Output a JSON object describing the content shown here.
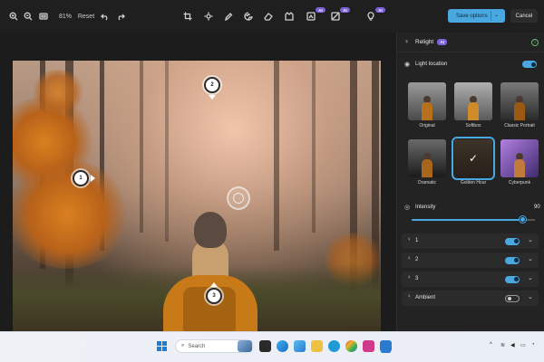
{
  "toolbar": {
    "zoom": "81%",
    "reset_label": "Reset",
    "ai_badge": "AI",
    "save_label": "Save options",
    "cancel_label": "Cancel",
    "icons": [
      "zoom-in-icon",
      "zoom-out-icon",
      "fit-icon",
      "undo-icon",
      "redo-icon",
      "crop-icon",
      "brightness-icon",
      "markup-icon",
      "color-icon",
      "erase-icon",
      "background-icon",
      "generative-erase-icon",
      "relight-icon"
    ]
  },
  "canvas": {
    "light_markers": [
      "1",
      "2",
      "3"
    ]
  },
  "panel": {
    "title": "Relight",
    "ai_badge": "AI",
    "light_location_label": "Light location",
    "light_location_on": true,
    "presets": [
      {
        "label": "Original",
        "selected": false
      },
      {
        "label": "Softbox",
        "selected": false
      },
      {
        "label": "Classic Portrait",
        "selected": false
      },
      {
        "label": "Dramatic",
        "selected": false
      },
      {
        "label": "Golden Hour",
        "selected": true
      },
      {
        "label": "Cyberpunk",
        "selected": false
      }
    ],
    "intensity_label": "Intensity",
    "intensity_value": "90",
    "intensity_fraction": 0.9,
    "lights": [
      {
        "label": "1",
        "on": true
      },
      {
        "label": "2",
        "on": true
      },
      {
        "label": "3",
        "on": true
      },
      {
        "label": "Ambient",
        "on": false
      }
    ]
  },
  "taskbar": {
    "search_placeholder": "Search"
  },
  "colors": {
    "accent": "#4aa8e0",
    "ai_badge": "#7c62d8",
    "panel_bg": "#232323"
  }
}
